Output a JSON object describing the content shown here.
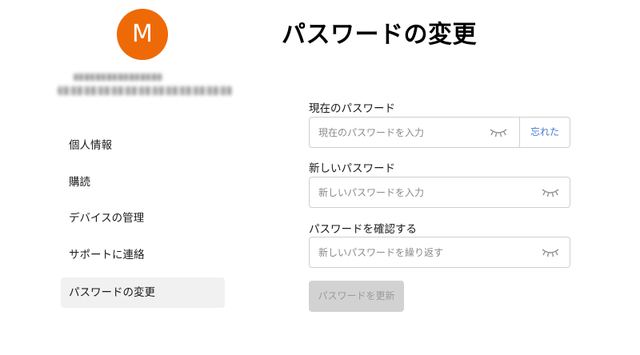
{
  "sidebar": {
    "avatar_letter": "M",
    "nav_items": [
      {
        "label": "個人情報"
      },
      {
        "label": "購読"
      },
      {
        "label": "デバイスの管理"
      },
      {
        "label": "サポートに連絡"
      },
      {
        "label": "パスワードの変更",
        "active": true
      }
    ]
  },
  "main": {
    "title": "パスワードの変更",
    "current_password": {
      "label": "現在のパスワード",
      "placeholder": "現在のパスワードを入力",
      "forgot_label": "忘れた"
    },
    "new_password": {
      "label": "新しいパスワード",
      "placeholder": "新しいパスワードを入力"
    },
    "confirm_password": {
      "label": "パスワードを確認する",
      "placeholder": "新しいパスワードを繰り返す"
    },
    "submit_label": "パスワードを更新"
  },
  "colors": {
    "avatar_bg": "#ee6a07",
    "link": "#4a7bd0",
    "active_nav_bg": "#f1f1f1",
    "disabled_button_bg": "#d2d2d2"
  },
  "icons": {
    "password_toggle": "eye-closed-icon"
  }
}
